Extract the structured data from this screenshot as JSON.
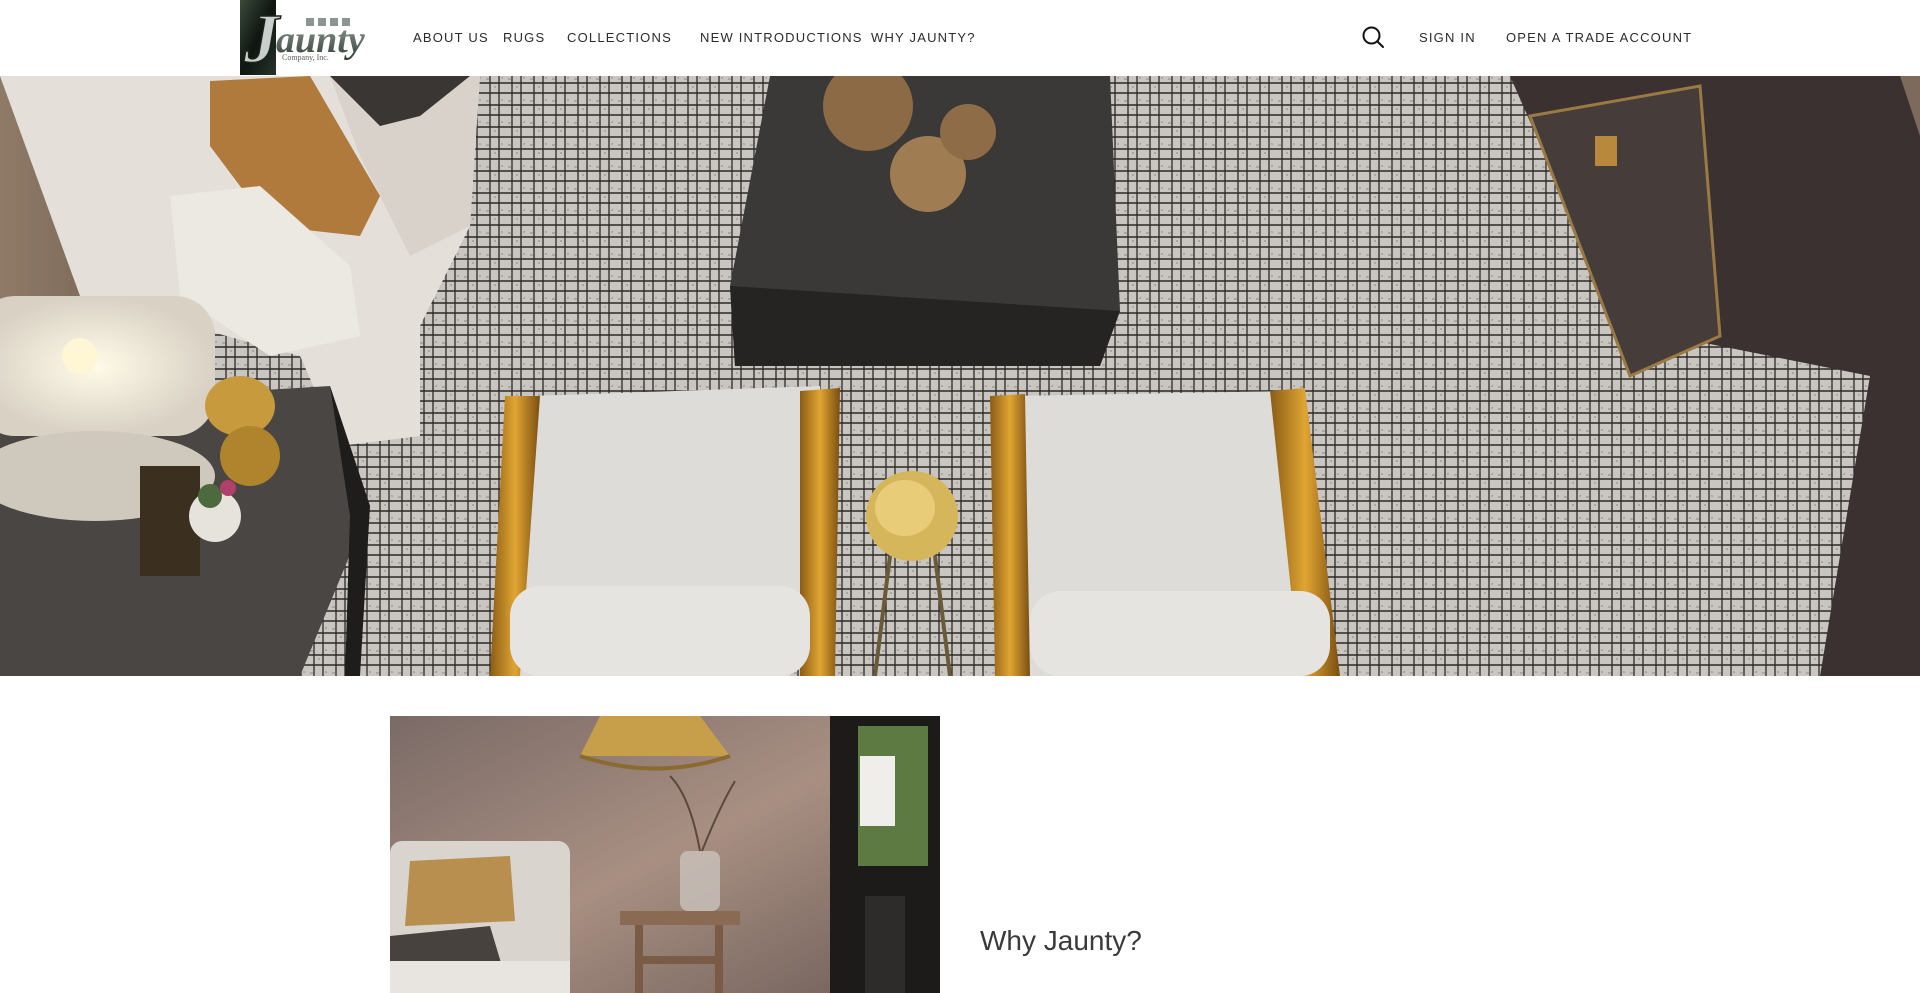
{
  "brand": {
    "logo_letters": "Jaunty",
    "logo_subtitle": "Company, Inc."
  },
  "nav": {
    "items": [
      {
        "id": "about",
        "label": "ABOUT US"
      },
      {
        "id": "rugs",
        "label": "RUGS"
      },
      {
        "id": "collections",
        "label": "COLLECTIONS"
      },
      {
        "id": "new",
        "label": "NEW INTRODUCTIONS"
      },
      {
        "id": "why",
        "label": "WHY JAUNTY?"
      }
    ],
    "sign_in": "SIGN IN",
    "trade_account": "OPEN A TRADE ACCOUNT",
    "search_icon": "search-icon"
  },
  "feature": {
    "heading": "Why Jaunty?"
  },
  "colors": {
    "text": "#2b2b2b",
    "heading": "#3a3a3a",
    "background": "#ffffff"
  }
}
